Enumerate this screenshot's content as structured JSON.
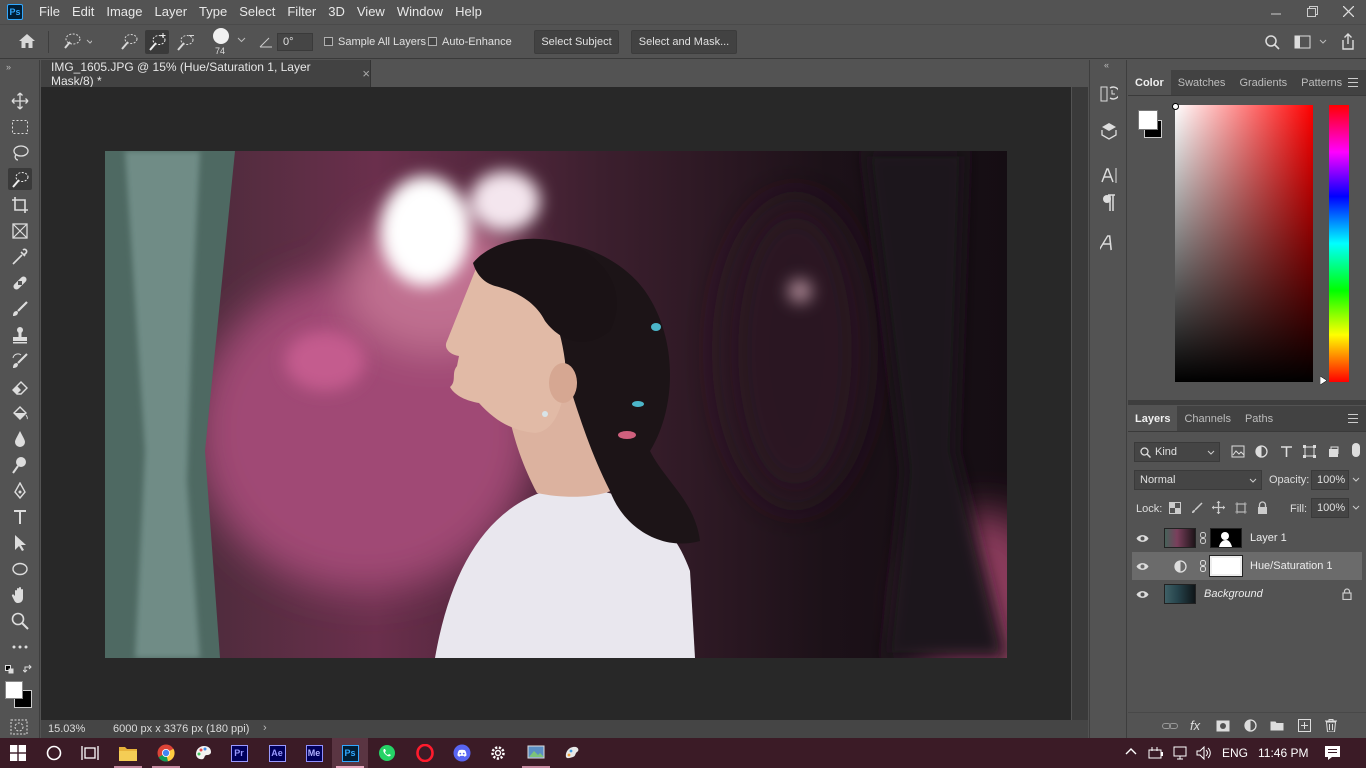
{
  "app": {
    "logo": "Ps"
  },
  "menu": [
    "File",
    "Edit",
    "Image",
    "Layer",
    "Type",
    "Select",
    "Filter",
    "3D",
    "View",
    "Window",
    "Help"
  ],
  "window_controls": [
    "minimize-icon",
    "restore-icon",
    "close-icon"
  ],
  "options_bar": {
    "brush_size": "74",
    "angle": "0°",
    "sample_all_layers": {
      "label": "Sample All Layers",
      "checked": false
    },
    "auto_enhance": {
      "label": "Auto-Enhance",
      "checked": false
    },
    "select_subject": "Select Subject",
    "select_and_mask": "Select and Mask..."
  },
  "document": {
    "tab_title": "IMG_1605.JPG @ 15% (Hue/Saturation 1, Layer Mask/8) *",
    "zoom": "15.03%",
    "info": "6000 px x 3376 px (180 ppi)"
  },
  "color_panel": {
    "tabs": [
      "Color",
      "Swatches",
      "Gradients",
      "Patterns"
    ],
    "active_tab": "Color",
    "foreground": "#ffffff",
    "background": "#000000",
    "hue_color": "#ff0000"
  },
  "layers_panel": {
    "tabs": [
      "Layers",
      "Channels",
      "Paths"
    ],
    "active_tab": "Layers",
    "filter_kind": "Kind",
    "blend_mode": "Normal",
    "opacity_label": "Opacity:",
    "opacity": "100%",
    "lock_label": "Lock:",
    "fill_label": "Fill:",
    "fill": "100%",
    "layers": [
      {
        "name": "Layer 1",
        "type": "pixel-with-mask",
        "selected": false,
        "locked": false
      },
      {
        "name": "Hue/Saturation 1",
        "type": "adjustment",
        "selected": true,
        "locked": false
      },
      {
        "name": "Background",
        "type": "background",
        "selected": false,
        "locked": true
      }
    ]
  },
  "taskbar": {
    "apps": [
      "file-explorer-icon",
      "chrome-icon",
      "paint-icon",
      "premiere-icon",
      "after-effects-icon",
      "media-encoder-icon",
      "photoshop-icon",
      "whatsapp-icon",
      "opera-icon",
      "discord-icon",
      "settings-icon",
      "photos-icon",
      "paint3d-icon"
    ],
    "app_labels": {
      "premiere": "Pr",
      "after_effects": "Ae",
      "media_encoder": "Me",
      "photoshop": "Ps"
    },
    "active_app": "photoshop-icon",
    "language": "ENG",
    "time": "11:46 PM"
  }
}
